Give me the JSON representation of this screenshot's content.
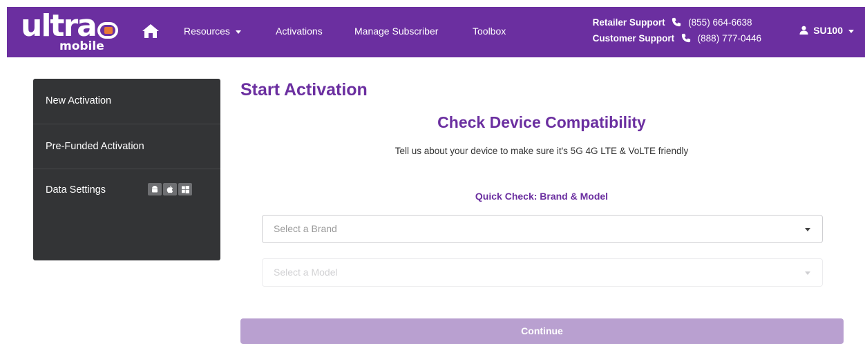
{
  "header": {
    "logo_word": "ultra",
    "logo_sub": "mobile",
    "nav": {
      "resources": "Resources",
      "activations": "Activations",
      "manage_subscriber": "Manage Subscriber",
      "toolbox": "Toolbox"
    },
    "support": {
      "retailer_label": "Retailer Support",
      "retailer_phone": "(855) 664-6638",
      "customer_label": "Customer Support",
      "customer_phone": "(888) 777-0446"
    },
    "user": "SU100"
  },
  "sidebar": {
    "items": [
      {
        "label": "New Activation"
      },
      {
        "label": "Pre-Funded Activation"
      },
      {
        "label": "Data Settings"
      }
    ],
    "os_icons": [
      "android-icon",
      "apple-icon",
      "windows-icon"
    ]
  },
  "main": {
    "title": "Start Activation",
    "section_title": "Check Device Compatibility",
    "subtext": "Tell us about your device to make sure it's 5G 4G LTE & VoLTE friendly",
    "quick_check_title": "Quick Check: Brand & Model",
    "brand_placeholder": "Select a Brand",
    "model_placeholder": "Select a Model",
    "continue_label": "Continue"
  },
  "colors": {
    "brand_purple": "#6b2fa0",
    "accent_orange": "#e87a35",
    "sidebar_bg": "#333436",
    "continue_disabled": "#b9a0d0"
  }
}
